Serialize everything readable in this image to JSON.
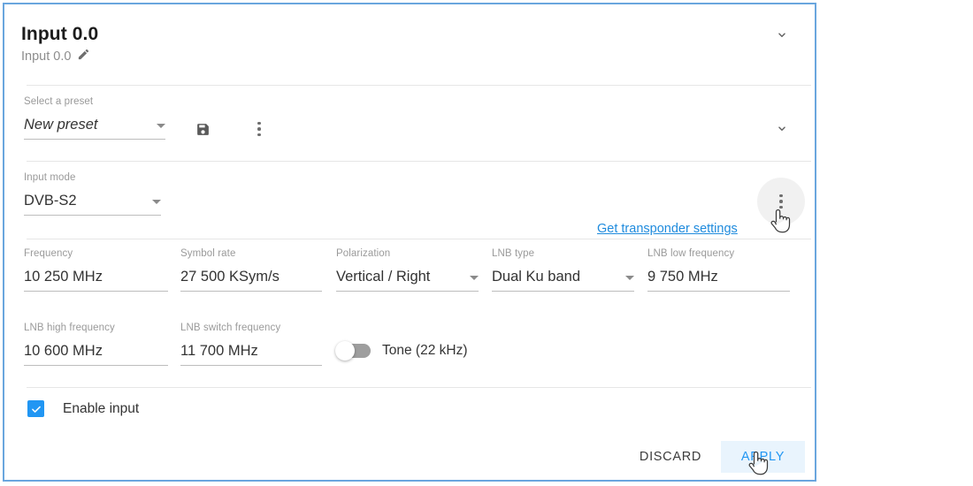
{
  "panel": {
    "header": {
      "title": "Input 0.0",
      "subtitle": "Input 0.0",
      "edit_icon": "pencil-icon",
      "expand_icon": "chevron-down-icon"
    },
    "preset_section": {
      "label": "Select a preset",
      "value": "New preset",
      "save_icon": "save-floppy-icon",
      "more_icon": "more-vertical-icon",
      "expand_icon": "chevron-down-icon"
    },
    "input_mode": {
      "label": "Input mode",
      "value": "DVB-S2"
    },
    "transponder_link": "Get transponder settings",
    "transponder_menu_icon": "more-vertical-icon",
    "fields": [
      {
        "label": "Frequency",
        "value": "10 250 MHz",
        "select": false
      },
      {
        "label": "Symbol rate",
        "value": "27 500 KSym/s",
        "select": false
      },
      {
        "label": "Polarization",
        "value": "Vertical / Right",
        "select": true
      },
      {
        "label": "LNB type",
        "value": "Dual Ku band",
        "select": true
      },
      {
        "label": "LNB low frequency",
        "value": "9 750 MHz",
        "select": false
      },
      {
        "label": "LNB high frequency",
        "value": "10 600 MHz",
        "select": false
      },
      {
        "label": "LNB switch frequency",
        "value": "11 700 MHz",
        "select": false
      }
    ],
    "tone_toggle": {
      "label": "Tone (22 kHz)",
      "state": "off"
    },
    "enable_input": {
      "label": "Enable input",
      "checked": true
    },
    "footer": {
      "discard_label": "DISCARD",
      "apply_label": "APPLY"
    }
  },
  "colors": {
    "panel_border": "#6aa6de",
    "accent_blue": "#2196f3",
    "link_blue": "#1f8bdd",
    "apply_hover_bg": "#e9f4fd",
    "label_gray": "#9a9a9a",
    "value_gray": "#333333",
    "divider": "#e6e6e6",
    "underline": "#bdbdbd",
    "toggle_track_off": "#9e9e9e"
  }
}
